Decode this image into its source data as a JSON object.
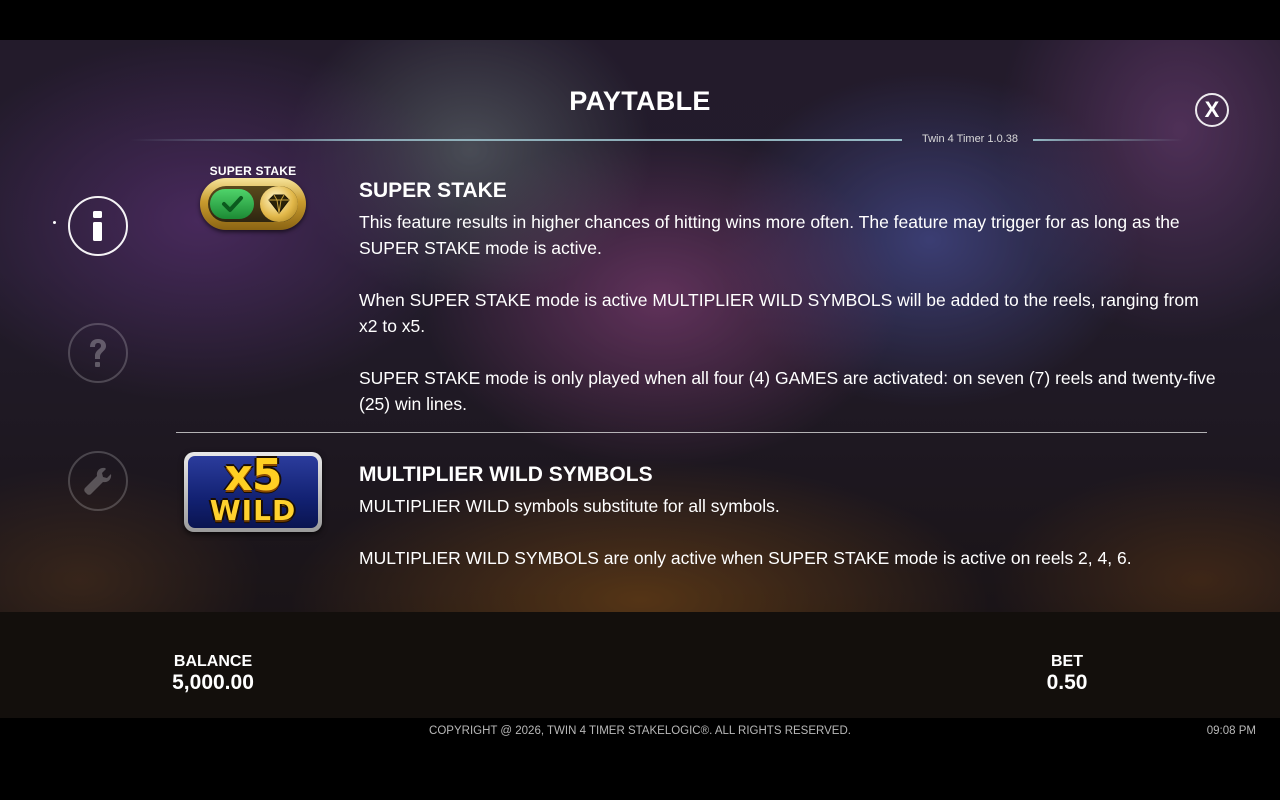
{
  "header": {
    "title": "PAYTABLE",
    "close_label": "X",
    "version": "Twin 4 Timer 1.0.38"
  },
  "nav": {
    "info_icon": "info-icon",
    "help_icon": "question-icon",
    "settings_icon": "wrench-icon"
  },
  "super_stake": {
    "badge_label": "SUPER STAKE",
    "heading": "SUPER STAKE",
    "paragraphs": [
      "This feature results in higher chances of hitting wins more often. The feature may trigger for as long as the SUPER STAKE mode is active.",
      "When SUPER STAKE mode is active MULTIPLIER WILD SYMBOLS will be added to the reels, ranging from x2 to x5.",
      "SUPER STAKE mode is only played when all four (4) GAMES are activated: on seven (7) reels and twenty-five (25) win lines."
    ]
  },
  "multiplier_wild": {
    "symbol_multiplier": "x5",
    "symbol_word": "WILD",
    "heading": "MULTIPLIER WILD SYMBOLS",
    "paragraphs": [
      "MULTIPLIER WILD symbols substitute for all symbols.",
      "MULTIPLIER WILD SYMBOLS are only active when SUPER STAKE mode is active on reels 2, 4, 6."
    ]
  },
  "status": {
    "balance_label": "BALANCE",
    "balance_value": "5,000.00",
    "bet_label": "BET",
    "bet_value": "0.50"
  },
  "footer": {
    "copyright": "COPYRIGHT @ 2026, TWIN 4 TIMER STAKELOGIC®. ALL RIGHTS RESERVED.",
    "time": "09:08 PM"
  },
  "colors": {
    "background": "#000000",
    "bottom_panel": "#130f0c",
    "accent_gold": "#ffcf23",
    "toggle_green": "#1c8a34"
  }
}
